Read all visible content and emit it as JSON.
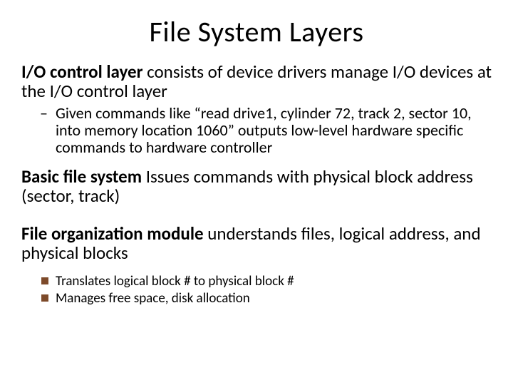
{
  "title": "File System Layers",
  "para1_bold": "I/O control layer",
  "para1_rest": " consists of device drivers manage I/O devices at the I/O control layer",
  "sub1_dash": "–",
  "sub1_text": "Given commands like “read drive1, cylinder 72, track 2, sector 10, into memory location 1060” outputs low-level hardware specific commands to hardware controller",
  "para2_bold": "Basic file system",
  "para2_rest": " Issues commands with physical block address (sector, track)",
  "para3_bold": "File organization module",
  "para3_rest": " understands files, logical address, and physical blocks",
  "bullet1": "Translates logical block # to physical block #",
  "bullet2": "Manages free space, disk allocation"
}
